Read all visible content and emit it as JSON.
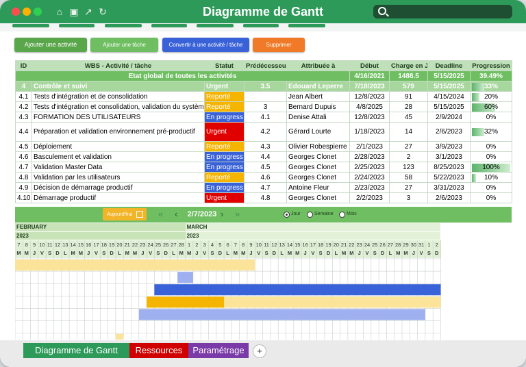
{
  "window": {
    "title": "Diagramme de Gantt"
  },
  "toolbar": {
    "add_activity": "Ajouter une activité",
    "add_task": "Ajouter une tâche",
    "convert": "Convertir à une activité / tâche",
    "delete": "Supprimer"
  },
  "table": {
    "headers": [
      "ID",
      "WBS - Activité / tâche",
      "Statut",
      "Prédécesseur",
      "Attribuée à",
      "Début",
      "Charge en J",
      "Deadline",
      "Progression"
    ],
    "summary": {
      "label": "Etat global de toutes les activités",
      "start": "4/16/2021",
      "load": "1488.5",
      "deadline": "5/15/2025",
      "progress": "39.49%"
    },
    "rows": [
      {
        "id": "4",
        "wbs": "Contrôle et suivi",
        "status": "Urgent",
        "pred": "3.5",
        "assignee": "Edouard Leperre",
        "start": "7/18/2023",
        "load": "579",
        "deadline": "5/15/2025",
        "progress": "33%",
        "pct": 33,
        "sub": true
      },
      {
        "id": "4.1",
        "wbs": "Tests d'intégration et de consolidation",
        "status": "Reporté",
        "pred": "",
        "assignee": "Jean Albert",
        "start": "12/8/2023",
        "load": "91",
        "deadline": "4/15/2024",
        "progress": "20%",
        "pct": 20
      },
      {
        "id": "4.2",
        "wbs": "Tests d'intégration et consolidation, validation du systèm",
        "status": "Reporté",
        "pred": "3",
        "assignee": "Bernard Dupuis",
        "start": "4/8/2025",
        "load": "28",
        "deadline": "5/15/2025",
        "progress": "60%",
        "pct": 60
      },
      {
        "id": "4.3",
        "wbs": "FORMATION DES UTILISATEURS",
        "status": "En progress",
        "pred": "4.1",
        "assignee": "Denise Attali",
        "start": "12/8/2023",
        "load": "45",
        "deadline": "2/9/2024",
        "progress": "0%",
        "pct": 0
      },
      {
        "id": "4.4",
        "wbs": "Préparation et validation environnement pré-productif",
        "status": "Urgent",
        "pred": "4.2",
        "assignee": "Gérard Lourte",
        "start": "1/18/2023",
        "load": "14",
        "deadline": "2/6/2023",
        "progress": "32%",
        "pct": 32,
        "tall": true
      },
      {
        "id": "4.5",
        "wbs": "Déploiement",
        "status": "Reporté",
        "pred": "4.3",
        "assignee": "Olivier Robespierre",
        "start": "2/1/2023",
        "load": "27",
        "deadline": "3/9/2023",
        "progress": "0%",
        "pct": 0
      },
      {
        "id": "4.6",
        "wbs": "Basculement et validation",
        "status": "En progress",
        "pred": "4.4",
        "assignee": "Georges Clonet",
        "start": "2/28/2023",
        "load": "2",
        "deadline": "3/1/2023",
        "progress": "0%",
        "pct": 0
      },
      {
        "id": "4.7",
        "wbs": "Validation Master Data",
        "status": "En progress",
        "pred": "4.5",
        "assignee": "Georges Clonet",
        "start": "2/25/2023",
        "load": "123",
        "deadline": "8/25/2023",
        "progress": "100%",
        "pct": 100
      },
      {
        "id": "4.8",
        "wbs": "Validation par les utilisateurs",
        "status": "Reporté",
        "pred": "4.6",
        "assignee": "Georges Clonet",
        "start": "2/24/2023",
        "load": "58",
        "deadline": "5/22/2023",
        "progress": "10%",
        "pct": 10
      },
      {
        "id": "4.9",
        "wbs": "Décision de démarrage productif",
        "status": "En progress",
        "pred": "4.7",
        "assignee": "Antoine Fleur",
        "start": "2/23/2023",
        "load": "27",
        "deadline": "3/31/2023",
        "progress": "0%",
        "pct": 0
      },
      {
        "id": "4.10",
        "wbs": "Démarrage productif",
        "status": "Urgent",
        "pred": "4.8",
        "assignee": "Georges Clonet",
        "start": "2/2/2023",
        "load": "3",
        "deadline": "2/6/2023",
        "progress": "0%",
        "pct": 0
      }
    ]
  },
  "status_colors": {
    "Urgent": "#e00000",
    "Reporté": "#f5b400",
    "En progress": "#3a62d8"
  },
  "timeline": {
    "today_label": "Aujourd'hui",
    "current_date": "2/7/2023",
    "views": [
      "Jour",
      "Semaine",
      "Mois"
    ],
    "selected_view": "Jour",
    "months": [
      {
        "name": "FEBRUARY",
        "year": "2023"
      },
      {
        "name": "MARCH",
        "year": "2023"
      }
    ],
    "days": [
      {
        "d": "7",
        "l": "M"
      },
      {
        "d": "8",
        "l": "M"
      },
      {
        "d": "9",
        "l": "J"
      },
      {
        "d": "10",
        "l": "V"
      },
      {
        "d": "11",
        "l": "S"
      },
      {
        "d": "12",
        "l": "D"
      },
      {
        "d": "13",
        "l": "L"
      },
      {
        "d": "14",
        "l": "M"
      },
      {
        "d": "15",
        "l": "M"
      },
      {
        "d": "16",
        "l": "J"
      },
      {
        "d": "17",
        "l": "V"
      },
      {
        "d": "18",
        "l": "S"
      },
      {
        "d": "19",
        "l": "D"
      },
      {
        "d": "20",
        "l": "L"
      },
      {
        "d": "21",
        "l": "M"
      },
      {
        "d": "22",
        "l": "M"
      },
      {
        "d": "23",
        "l": "J"
      },
      {
        "d": "24",
        "l": "V"
      },
      {
        "d": "25",
        "l": "S"
      },
      {
        "d": "26",
        "l": "D"
      },
      {
        "d": "27",
        "l": "L"
      },
      {
        "d": "28",
        "l": "M"
      },
      {
        "d": "1",
        "l": "M"
      },
      {
        "d": "2",
        "l": "J"
      },
      {
        "d": "3",
        "l": "V"
      },
      {
        "d": "4",
        "l": "S"
      },
      {
        "d": "5",
        "l": "D"
      },
      {
        "d": "6",
        "l": "L"
      },
      {
        "d": "7",
        "l": "M"
      },
      {
        "d": "8",
        "l": "M"
      },
      {
        "d": "9",
        "l": "J"
      },
      {
        "d": "10",
        "l": "V"
      },
      {
        "d": "11",
        "l": "S"
      },
      {
        "d": "12",
        "l": "D"
      },
      {
        "d": "13",
        "l": "L"
      },
      {
        "d": "14",
        "l": "M"
      },
      {
        "d": "15",
        "l": "M"
      },
      {
        "d": "16",
        "l": "J"
      },
      {
        "d": "17",
        "l": "V"
      },
      {
        "d": "18",
        "l": "S"
      },
      {
        "d": "19",
        "l": "D"
      },
      {
        "d": "20",
        "l": "L"
      },
      {
        "d": "21",
        "l": "M"
      },
      {
        "d": "22",
        "l": "M"
      },
      {
        "d": "23",
        "l": "J"
      },
      {
        "d": "24",
        "l": "V"
      },
      {
        "d": "25",
        "l": "S"
      },
      {
        "d": "26",
        "l": "D"
      },
      {
        "d": "27",
        "l": "L"
      },
      {
        "d": "28",
        "l": "M"
      },
      {
        "d": "29",
        "l": "M"
      },
      {
        "d": "30",
        "l": "J"
      },
      {
        "d": "31",
        "l": "V"
      },
      {
        "d": "1",
        "l": "S"
      },
      {
        "d": "2",
        "l": "D"
      }
    ]
  },
  "gantt_bars": [
    {
      "row": 0,
      "start": "2/7/2023",
      "end": "3/9/2023",
      "color": "#fbe39a"
    },
    {
      "row": 1,
      "start": "2/28/2023",
      "end": "3/1/2023",
      "color": "#9fb0f0"
    },
    {
      "row": 2,
      "start": "2/25/2023",
      "end": "4/2/2023",
      "color": "#3a62d8"
    },
    {
      "row": 3,
      "start": "2/24/2023",
      "end": "3/5/2023",
      "color": "#f5b400"
    },
    {
      "row": 3,
      "start": "3/6/2023",
      "end": "4/2/2023",
      "color": "#fbe39a"
    },
    {
      "row": 4,
      "start": "2/23/2023",
      "end": "3/31/2023",
      "color": "#9fb0f0"
    },
    {
      "row": 6,
      "start": "2/20/2023",
      "end": "2/20/2023",
      "color": "#fbe39a"
    },
    {
      "row": 7,
      "start": "2/18/2023",
      "end": "4/2/2023",
      "color": "#3a62d8"
    }
  ],
  "sheets": {
    "gantt": "Diagramme de Gantt",
    "resources": "Ressources",
    "settings": "Paramétrage",
    "add": "+"
  },
  "colors": {
    "accent": "#2e9a5a",
    "header_bg": "#bfe0b9",
    "summary_bg": "#6fbf62"
  }
}
